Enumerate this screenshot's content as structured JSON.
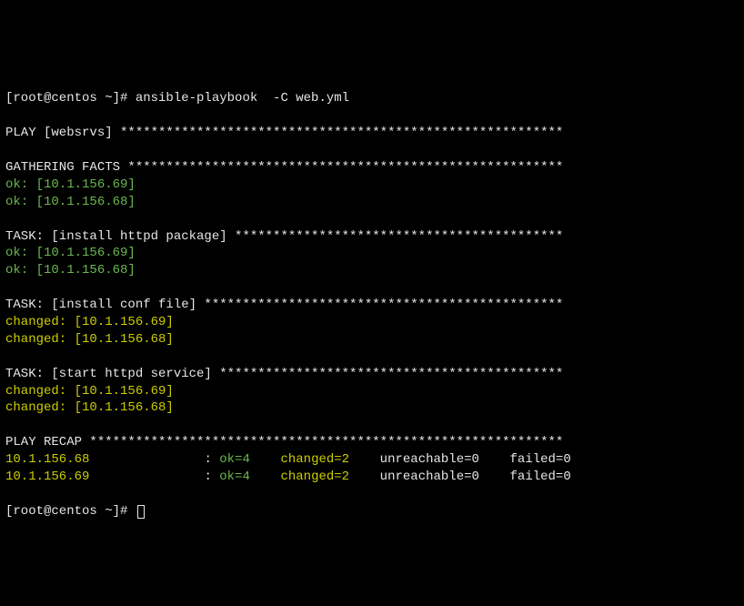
{
  "prompt1": "[root@centos ~]# ansible-playbook  -C web.yml",
  "blank": "",
  "play_header": "PLAY [websrvs] ********************************************************** ",
  "gathering_header": "GATHERING FACTS ********************************************************* ",
  "gf_host1": "ok: [10.1.156.69]",
  "gf_host2": "ok: [10.1.156.68]",
  "task1_header": "TASK: [install httpd package] ******************************************* ",
  "t1_host1": "ok: [10.1.156.69]",
  "t1_host2": "ok: [10.1.156.68]",
  "task2_header": "TASK: [install conf file] *********************************************** ",
  "t2_host1": "changed: [10.1.156.69]",
  "t2_host2": "changed: [10.1.156.68]",
  "task3_header": "TASK: [start httpd service] ********************************************* ",
  "t3_host1": "changed: [10.1.156.69]",
  "t3_host2": "changed: [10.1.156.68]",
  "recap_header": "PLAY RECAP ************************************************************** ",
  "recap1_host": "10.1.156.68",
  "recap1_sep": "               : ",
  "recap1_ok": "ok=4",
  "recap1_changed": "    changed=2",
  "recap1_unreachable": "    unreachable=0",
  "recap1_failed": "    failed=0",
  "recap2_host": "10.1.156.69",
  "recap2_sep": "               : ",
  "recap2_ok": "ok=4",
  "recap2_changed": "    changed=2",
  "recap2_unreachable": "    unreachable=0",
  "recap2_failed": "    failed=0",
  "prompt2": "[root@centos ~]# "
}
